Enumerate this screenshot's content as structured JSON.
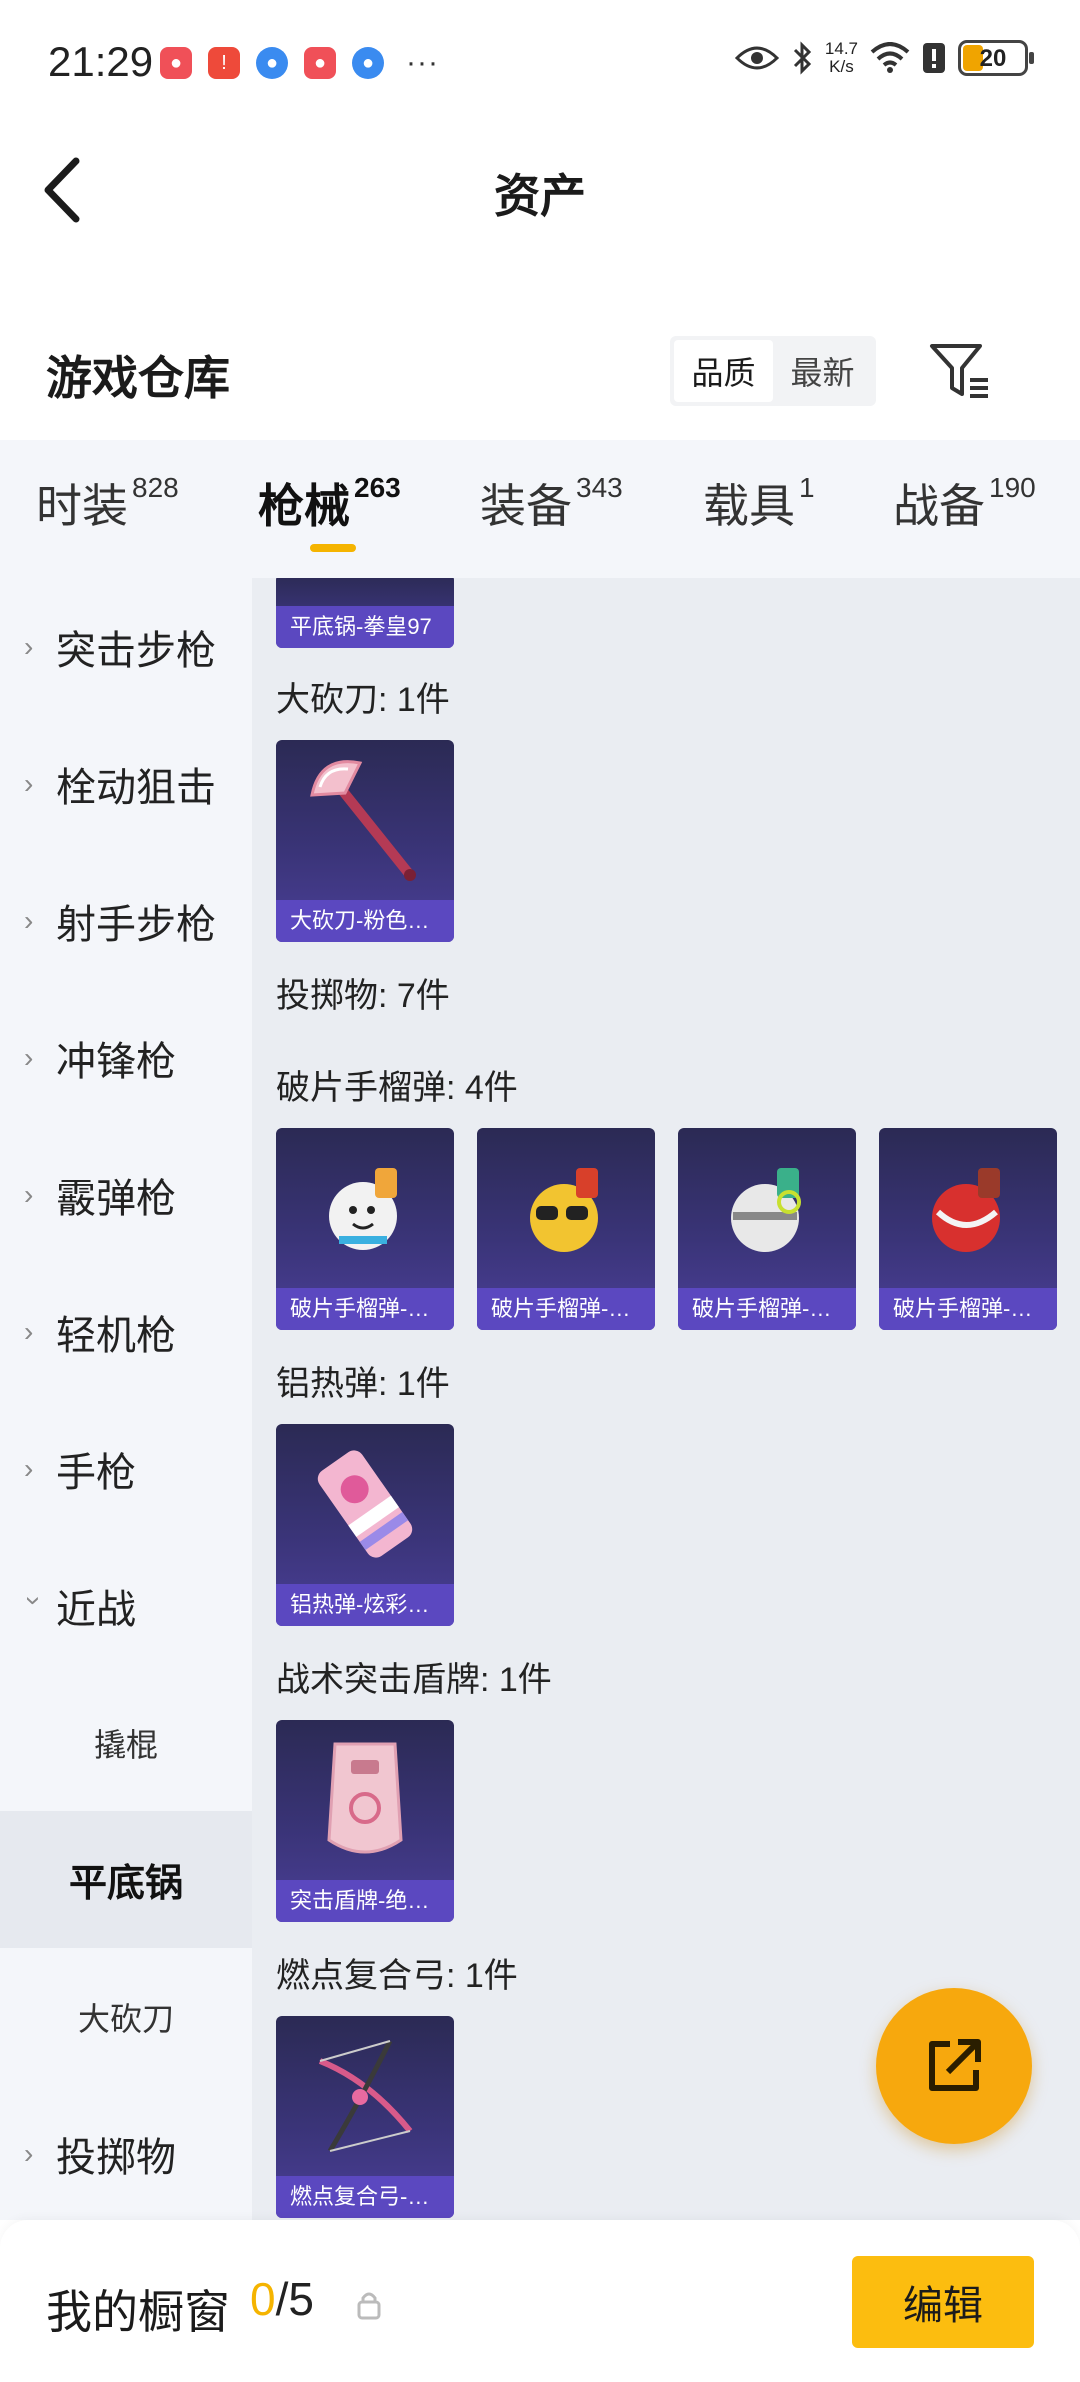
{
  "status_bar": {
    "time": "21:29",
    "more": "···",
    "net_speed_value": "14.7",
    "net_speed_unit": "K/s",
    "battery": "20",
    "battery_level": 0.2
  },
  "header": {
    "title": "资产"
  },
  "warehouse": {
    "title": "游戏仓库",
    "sort": [
      "品质",
      "最新"
    ],
    "sort_active": "品质"
  },
  "tabs": [
    {
      "label": "时装",
      "count": "828"
    },
    {
      "label": "枪械",
      "count": "263"
    },
    {
      "label": "装备",
      "count": "343"
    },
    {
      "label": "载具",
      "count": "1"
    },
    {
      "label": "战备",
      "count": "190"
    }
  ],
  "active_tab": "枪械",
  "sidebar": {
    "items": [
      {
        "label": "突击步枪"
      },
      {
        "label": "栓动狙击"
      },
      {
        "label": "射手步枪"
      },
      {
        "label": "冲锋枪"
      },
      {
        "label": "霰弹枪"
      },
      {
        "label": "轻机枪"
      },
      {
        "label": "手枪"
      },
      {
        "label": "近战"
      }
    ],
    "sub_items": [
      {
        "label": "撬棍"
      },
      {
        "label": "平底锅"
      },
      {
        "label": "大砍刀"
      }
    ],
    "last_item": {
      "label": "投掷物"
    },
    "active_sub": "平底锅"
  },
  "content": {
    "top_card": {
      "name": "平底锅-拳皇97"
    },
    "sections": [
      {
        "label": "大砍刀: 1件",
        "cards": [
          {
            "name": "大砍刀-粉色…"
          }
        ]
      },
      {
        "label": "投掷物: 7件"
      },
      {
        "label": "破片手榴弹: 4件",
        "cards": [
          {
            "name": "破片手榴弹-…"
          },
          {
            "name": "破片手榴弹-…"
          },
          {
            "name": "破片手榴弹-…"
          },
          {
            "name": "破片手榴弹-…"
          }
        ]
      },
      {
        "label": "铝热弹: 1件",
        "cards": [
          {
            "name": "铝热弹-炫彩…"
          }
        ]
      },
      {
        "label": "战术突击盾牌: 1件",
        "cards": [
          {
            "name": "突击盾牌-绝…"
          }
        ]
      },
      {
        "label": "燃点复合弓: 1件",
        "cards": [
          {
            "name": "燃点复合弓-…"
          }
        ]
      }
    ]
  },
  "bottom_bar": {
    "title": "我的橱窗",
    "count_current": "0",
    "count_total": "/5",
    "edit_label": "编辑"
  },
  "colors": {
    "accent": "#f5b400",
    "fab": "#f7a80d",
    "edit_button": "#fcbd0f",
    "card_bg": "#3a3478",
    "card_label_bg": "#5b48c0"
  }
}
